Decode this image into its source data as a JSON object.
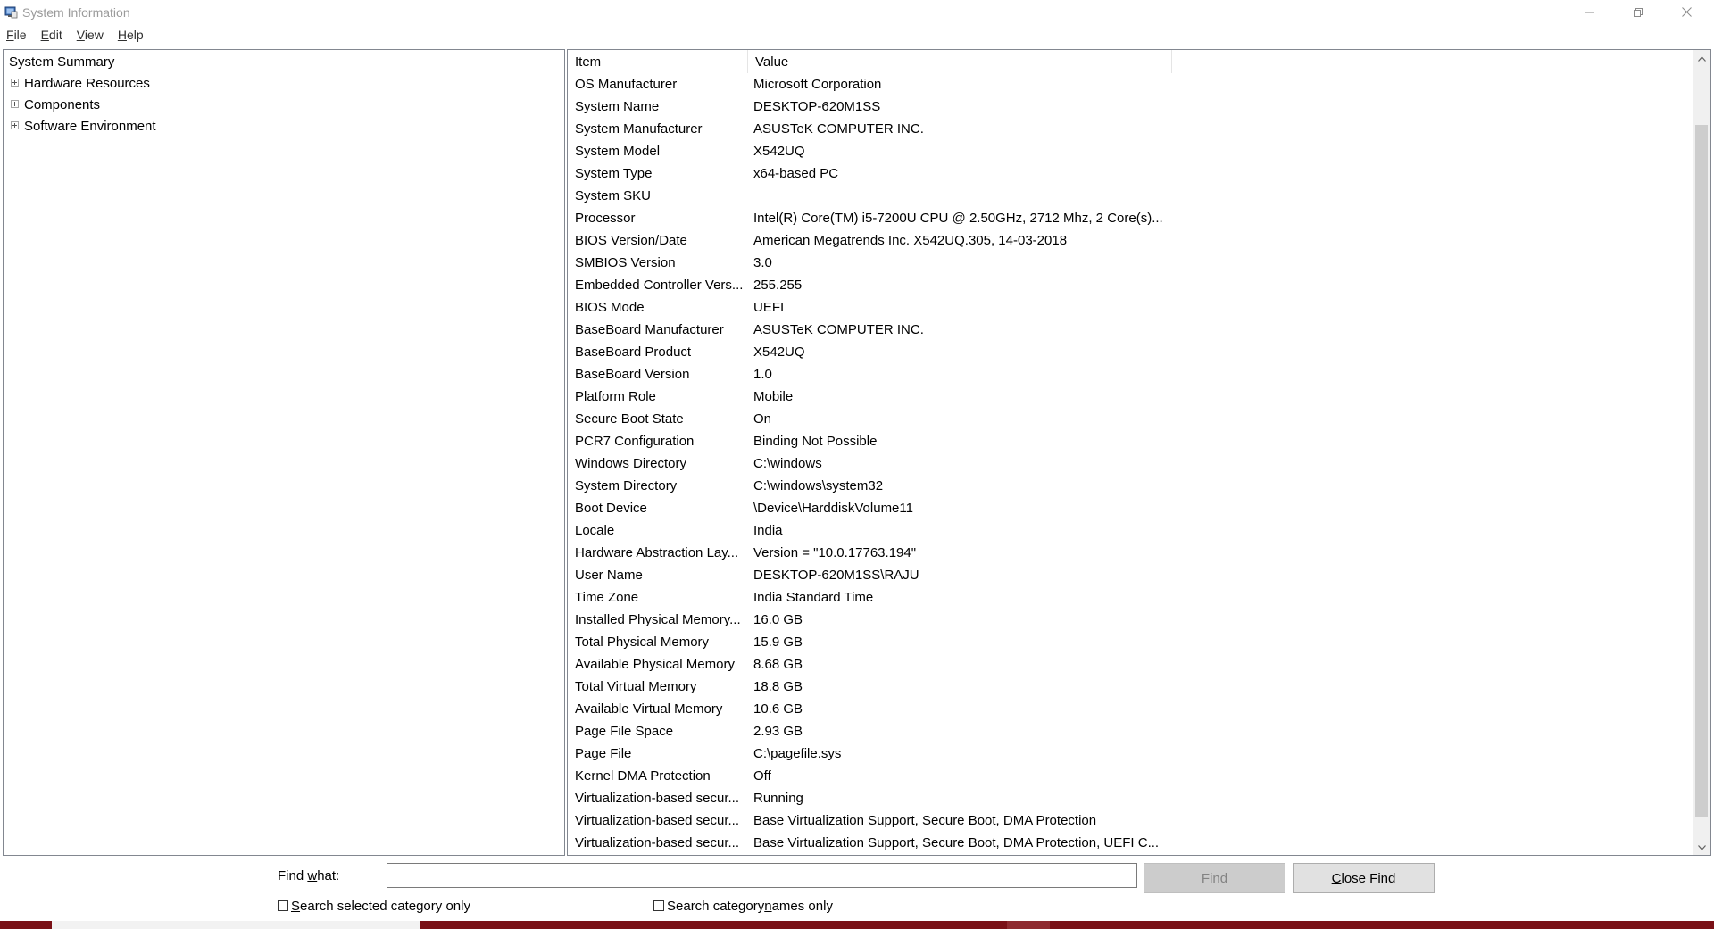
{
  "window": {
    "title": "System Information"
  },
  "menu": {
    "items": [
      {
        "label": "File",
        "mnemonic": "F",
        "rest": "ile"
      },
      {
        "label": "Edit",
        "mnemonic": "E",
        "rest": "dit"
      },
      {
        "label": "View",
        "mnemonic": "V",
        "rest": "iew"
      },
      {
        "label": "Help",
        "mnemonic": "H",
        "rest": "elp"
      }
    ]
  },
  "tree": {
    "root": "System Summary",
    "children": [
      "Hardware Resources",
      "Components",
      "Software Environment"
    ]
  },
  "list": {
    "headers": {
      "item": "Item",
      "value": "Value"
    },
    "rows": [
      {
        "item": "OS Manufacturer",
        "value": "Microsoft Corporation"
      },
      {
        "item": "System Name",
        "value": "DESKTOP-620M1SS"
      },
      {
        "item": "System Manufacturer",
        "value": "ASUSTeK COMPUTER INC."
      },
      {
        "item": "System Model",
        "value": "X542UQ"
      },
      {
        "item": "System Type",
        "value": "x64-based PC"
      },
      {
        "item": "System SKU",
        "value": ""
      },
      {
        "item": "Processor",
        "value": "Intel(R) Core(TM) i5-7200U CPU @ 2.50GHz, 2712 Mhz, 2 Core(s)..."
      },
      {
        "item": "BIOS Version/Date",
        "value": "American Megatrends Inc. X542UQ.305, 14-03-2018"
      },
      {
        "item": "SMBIOS Version",
        "value": "3.0"
      },
      {
        "item": "Embedded Controller Vers...",
        "value": "255.255"
      },
      {
        "item": "BIOS Mode",
        "value": "UEFI"
      },
      {
        "item": "BaseBoard Manufacturer",
        "value": "ASUSTeK COMPUTER INC."
      },
      {
        "item": "BaseBoard Product",
        "value": "X542UQ"
      },
      {
        "item": "BaseBoard Version",
        "value": "1.0"
      },
      {
        "item": "Platform Role",
        "value": "Mobile"
      },
      {
        "item": "Secure Boot State",
        "value": "On"
      },
      {
        "item": "PCR7 Configuration",
        "value": "Binding Not Possible"
      },
      {
        "item": "Windows Directory",
        "value": "C:\\windows"
      },
      {
        "item": "System Directory",
        "value": "C:\\windows\\system32"
      },
      {
        "item": "Boot Device",
        "value": "\\Device\\HarddiskVolume11"
      },
      {
        "item": "Locale",
        "value": "India"
      },
      {
        "item": "Hardware Abstraction Lay...",
        "value": "Version = \"10.0.17763.194\""
      },
      {
        "item": "User Name",
        "value": "DESKTOP-620M1SS\\RAJU"
      },
      {
        "item": "Time Zone",
        "value": "India Standard Time"
      },
      {
        "item": "Installed Physical Memory...",
        "value": "16.0 GB"
      },
      {
        "item": "Total Physical Memory",
        "value": "15.9 GB"
      },
      {
        "item": "Available Physical Memory",
        "value": "8.68 GB"
      },
      {
        "item": "Total Virtual Memory",
        "value": "18.8 GB"
      },
      {
        "item": "Available Virtual Memory",
        "value": "10.6 GB"
      },
      {
        "item": "Page File Space",
        "value": "2.93 GB"
      },
      {
        "item": "Page File",
        "value": "C:\\pagefile.sys"
      },
      {
        "item": "Kernel DMA Protection",
        "value": "Off"
      },
      {
        "item": "Virtualization-based secur...",
        "value": "Running"
      },
      {
        "item": "Virtualization-based secur...",
        "value": "Base Virtualization Support, Secure Boot, DMA Protection"
      },
      {
        "item": "Virtualization-based secur...",
        "value": "Base Virtualization Support, Secure Boot, DMA Protection, UEFI C..."
      }
    ]
  },
  "find": {
    "label_pre": "Find ",
    "label_mnemonic": "w",
    "label_post": "hat:",
    "input_value": "",
    "find_button": "Find",
    "close_button_mnemonic": "C",
    "close_button_rest": "lose Find",
    "check_selected_mnemonic": "S",
    "check_selected_rest": "earch selected category only",
    "check_names_pre": "Search category ",
    "check_names_mnemonic": "n",
    "check_names_post": "ames only",
    "check_selected_checked": false,
    "check_names_checked": false
  },
  "colors": {
    "taskbar": "#7a1016",
    "border": "#828790",
    "scroll_thumb": "#cdcdcd",
    "disabled_button": "#cccccc"
  },
  "icons": {
    "app": "system-information-icon",
    "minimize": "minimize-icon",
    "restore": "restore-icon",
    "close": "close-icon",
    "expander": "plus-expander-icon",
    "scroll_up": "scroll-up-arrow-icon",
    "scroll_down": "scroll-down-arrow-icon"
  }
}
